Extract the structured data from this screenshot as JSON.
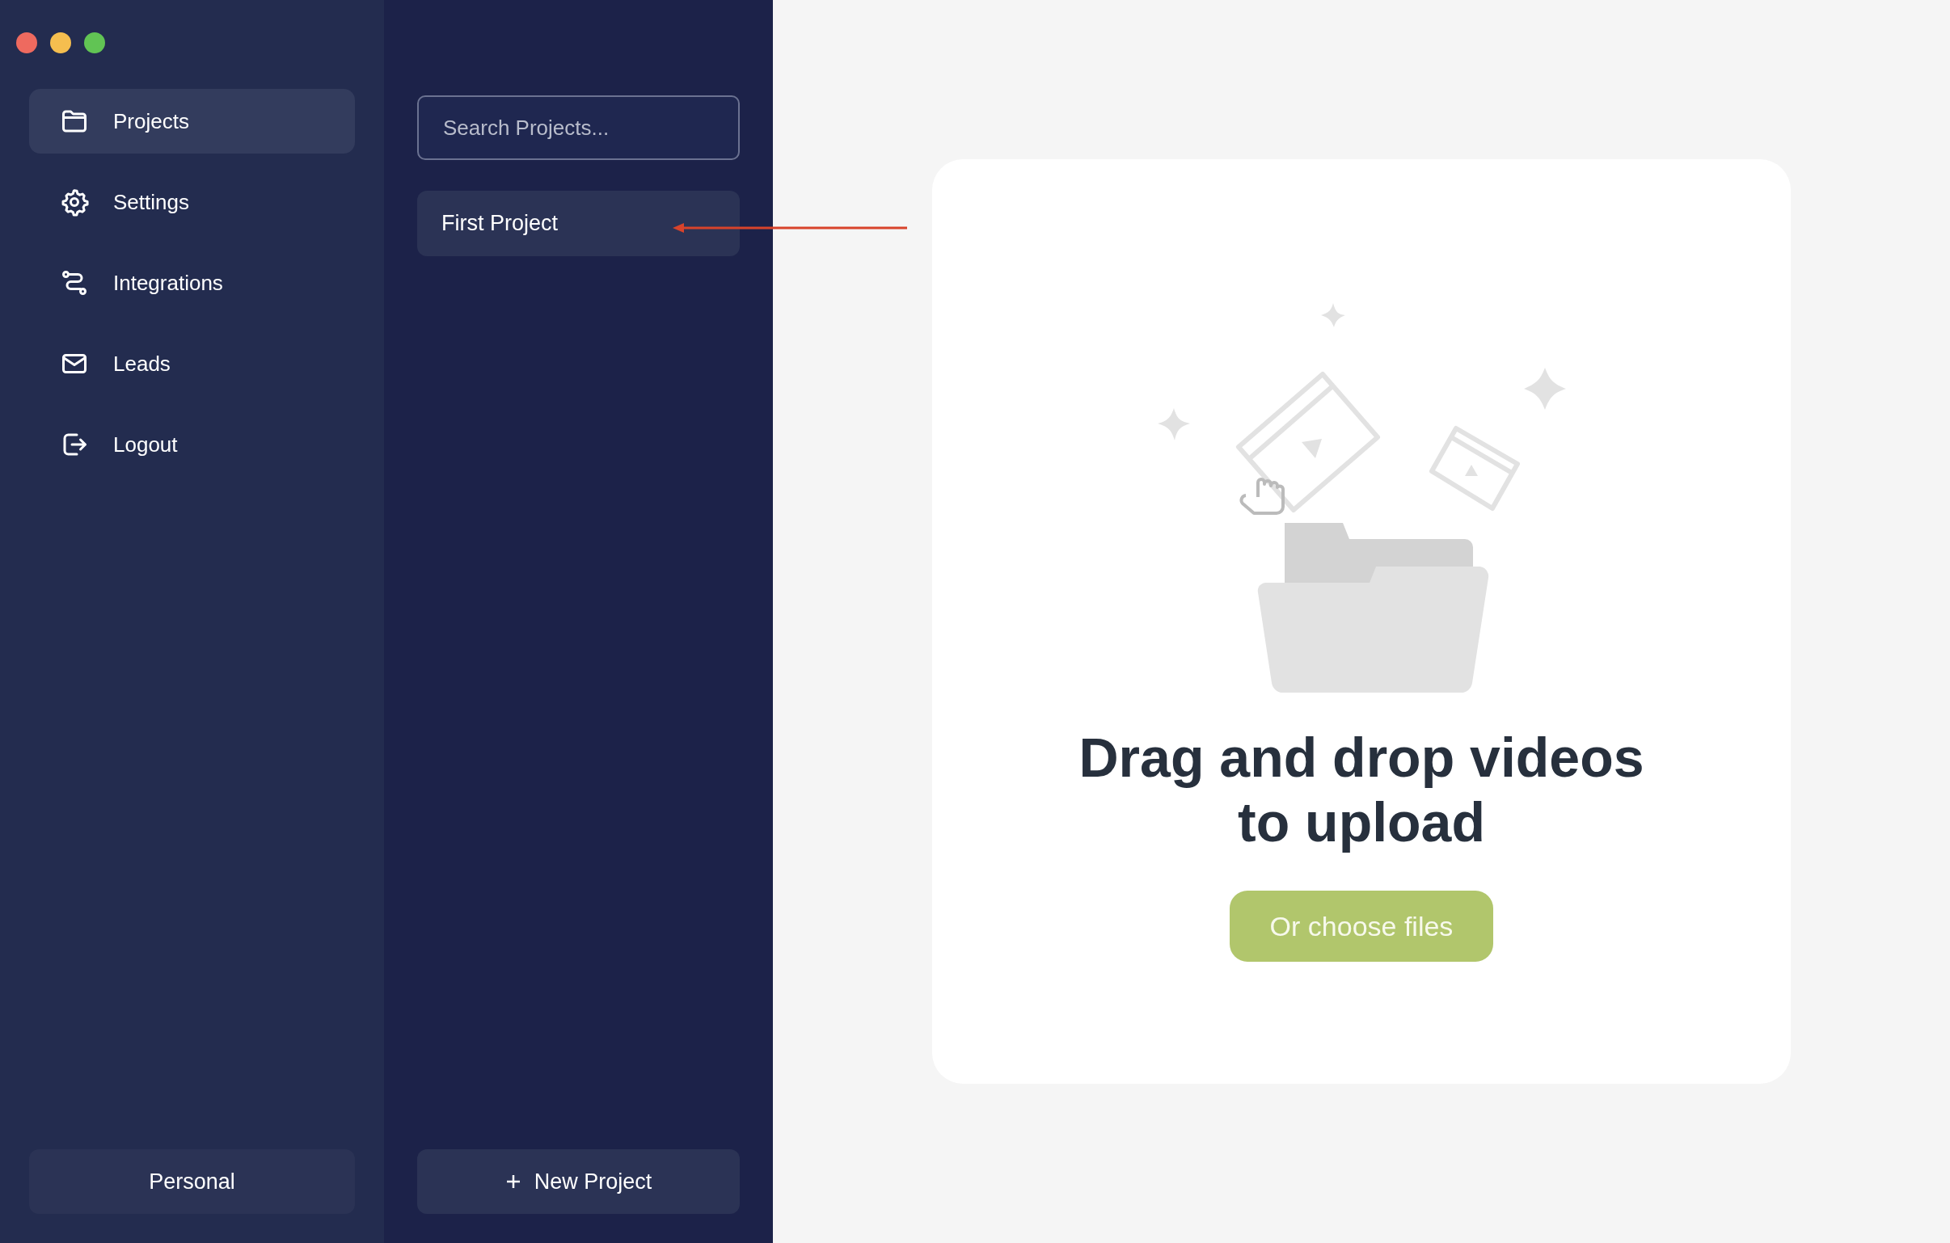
{
  "nav": [
    {
      "label": "Projects",
      "selected": true
    },
    {
      "label": "Settings",
      "selected": false
    },
    {
      "label": "Integrations",
      "selected": false
    },
    {
      "label": "Leads",
      "selected": false
    },
    {
      "label": "Logout",
      "selected": false
    }
  ],
  "workspace_button": "Personal",
  "search": {
    "placeholder": "Search Projects..."
  },
  "projects": [
    {
      "name": "First Project",
      "selected": true
    }
  ],
  "new_project_button": "New Project",
  "dropzone": {
    "title": "Drag and drop videos to upload",
    "button": "Or choose files"
  }
}
